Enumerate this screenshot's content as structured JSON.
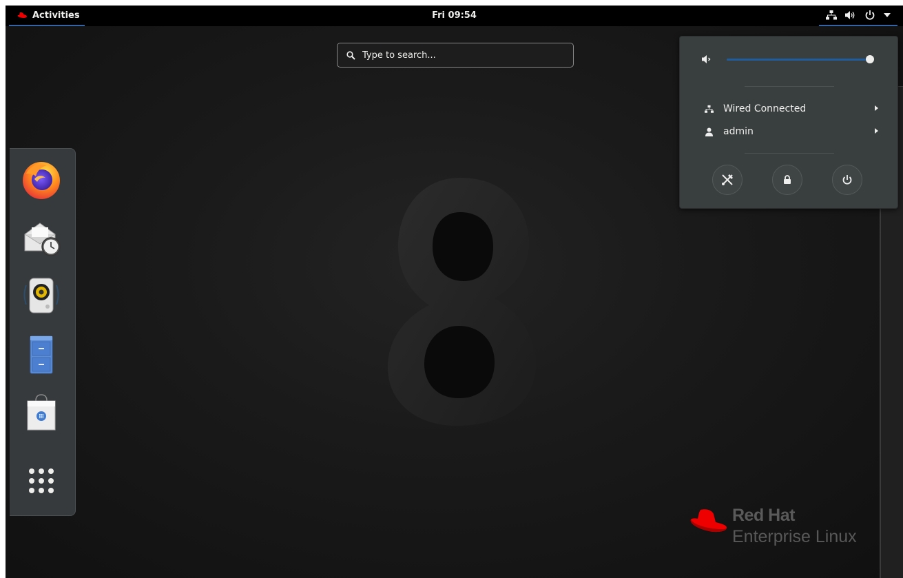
{
  "topbar": {
    "activities_label": "Activities",
    "clock": "Fri 09:54"
  },
  "search": {
    "placeholder": "Type to search..."
  },
  "dash": {
    "items": [
      {
        "name": "firefox",
        "icon": "firefox-icon"
      },
      {
        "name": "evolution",
        "icon": "mail-clock-icon"
      },
      {
        "name": "rhythmbox",
        "icon": "speaker-icon"
      },
      {
        "name": "files",
        "icon": "file-cabinet-icon"
      },
      {
        "name": "software",
        "icon": "shopping-bag-icon"
      },
      {
        "name": "show-applications",
        "icon": "app-grid-icon"
      }
    ]
  },
  "system_menu": {
    "volume_level": 1.0,
    "network_label": "Wired Connected",
    "user_label": "admin",
    "buttons": [
      "settings-icon",
      "lock-icon",
      "power-icon"
    ]
  },
  "wallpaper": {
    "numeral": "8"
  },
  "brand": {
    "line1": "Red Hat",
    "line2": "Enterprise Linux"
  },
  "colors": {
    "accent": "#3465a4",
    "redhat_red": "#ee0000",
    "menu_bg": "#393f3f",
    "dash_bg": "#383c3f"
  }
}
